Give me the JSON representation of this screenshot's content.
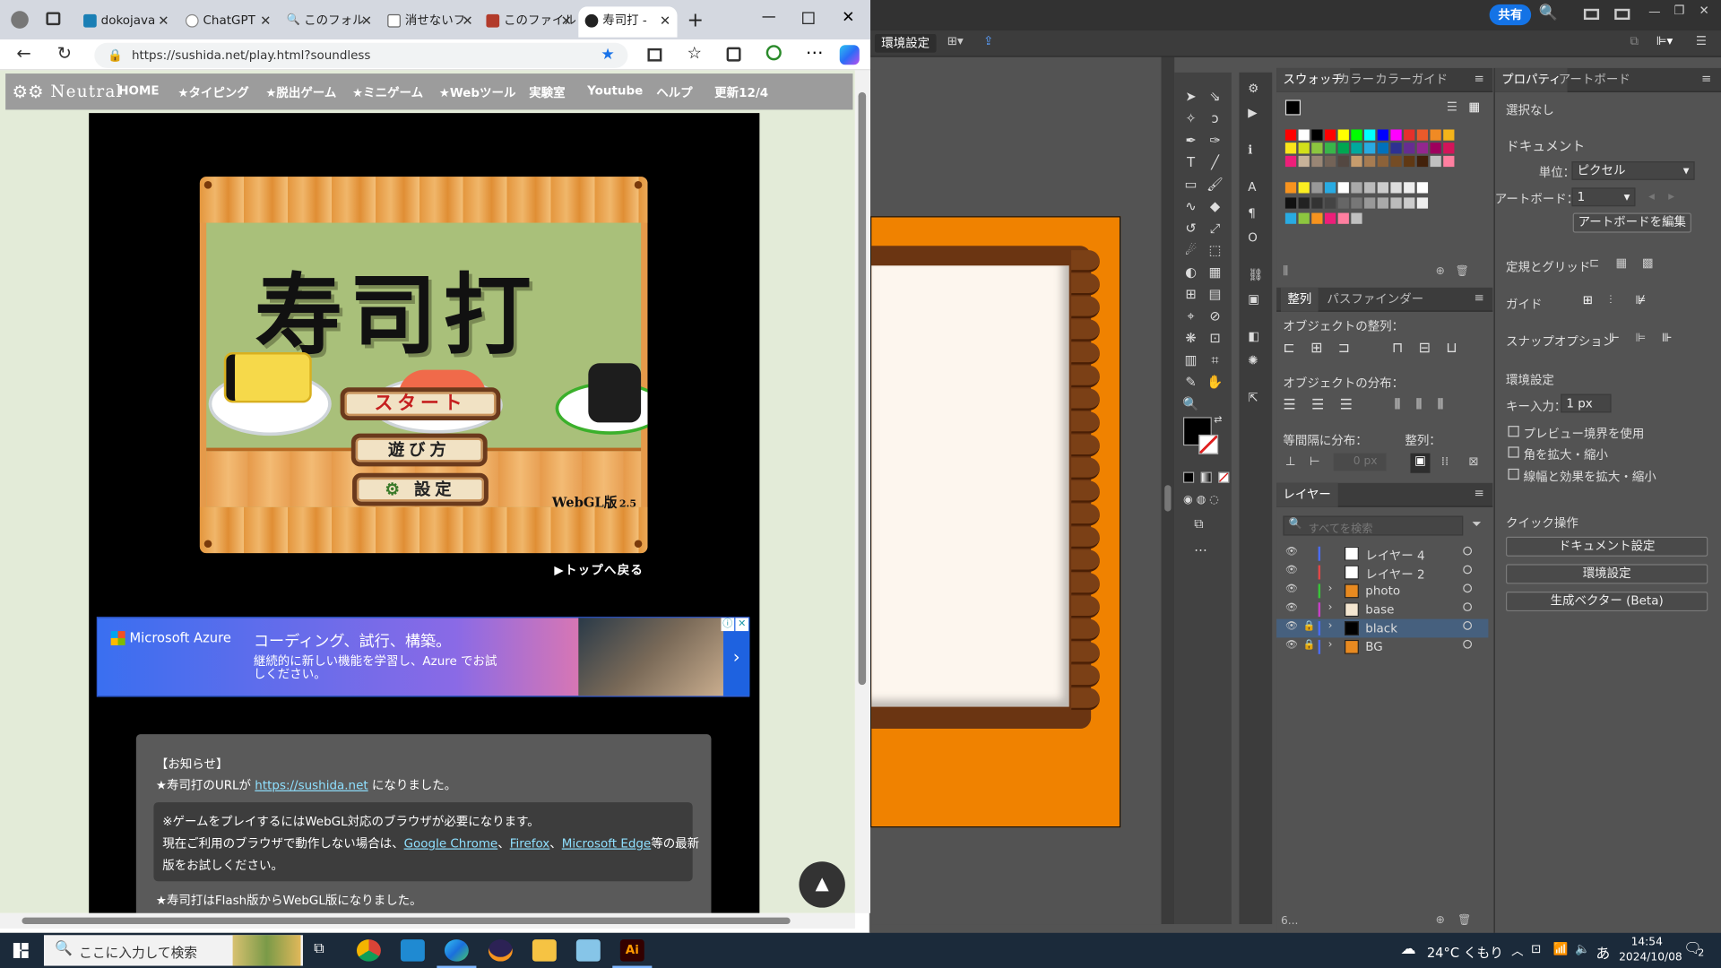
{
  "browser": {
    "tabs": [
      {
        "label": "dokojava",
        "color": "#1a7fb5"
      },
      {
        "label": "ChatGPT",
        "color": "#888888"
      },
      {
        "label": "このフォル",
        "color": "#aaaaaa"
      },
      {
        "label": "消せないフ",
        "color": "#aaaaaa"
      },
      {
        "label": "このファイル",
        "color": "#b23b2b"
      },
      {
        "label": "寿司打 - ",
        "color": "#222222"
      }
    ],
    "new_tab": "+",
    "url": "https://sushida.net/play.html?soundless"
  },
  "site": {
    "logo": "Neutral",
    "nav": [
      "HOME",
      "★タイピング",
      "★脱出ゲーム",
      "★ミニゲーム",
      "★Webツール",
      "実験室",
      "Youtube",
      "ヘルプ",
      "更新12/4"
    ],
    "game": {
      "title": "寿司打",
      "start": "スタート",
      "howto": "遊び方",
      "settings": "設定",
      "version": "WebGL版",
      "version_num": "2.5"
    },
    "back_to_top": "▶トップへ戻る",
    "ad": {
      "brand": "Microsoft Azure",
      "headline": "コーディング、試行、構築。",
      "body": "継続的に新しい機能を学習し、Azure でお試しください。"
    },
    "notice": {
      "heading": "【お知らせ】",
      "line1_pre": "★寿司打のURLが",
      "line1_link": "https://sushida.net",
      "line1_post": "になりました。",
      "box_line1": "※ゲームをプレイするにはWebGL対応のブラウザが必要になります。",
      "box_line2_pre": "現在ご利用のブラウザで動作しない場合は、",
      "chrome": "Google Chrome",
      "sep": "、",
      "firefox": "Firefox",
      "edge": "Microsoft Edge",
      "box_line2_post": "等の最新",
      "box_line3": "版をお試しください。",
      "line_last": "★寿司打はFlash版からWebGL版になりました。"
    }
  },
  "illustrator": {
    "share": "共有",
    "env_btn": "環境設定",
    "swatch_tabs": [
      "スウォッチ",
      "カラー",
      "カラーガイド"
    ],
    "align_tabs": [
      "整列",
      "パスファインダー"
    ],
    "align_objects": "オブジェクトの整列：",
    "distribute_objects": "オブジェクトの分布：",
    "equal_spacing": "等間隔に分布：",
    "align_to": "整列：",
    "spacing_value": "0 px",
    "layers_tab": "レイヤー",
    "layers_search": "すべてを検索",
    "layers": [
      {
        "name": "レイヤー 4",
        "color": "#4b6cf0",
        "locked": false,
        "expandable": false
      },
      {
        "name": "レイヤー 2",
        "color": "#e04848",
        "locked": false,
        "expandable": false
      },
      {
        "name": "photo",
        "color": "#39c339",
        "locked": false,
        "expandable": true
      },
      {
        "name": "base",
        "color": "#c640c6",
        "locked": false,
        "expandable": true
      },
      {
        "name": "black",
        "color": "#4b6cf0",
        "locked": true,
        "expandable": true
      },
      {
        "name": "BG",
        "color": "#4b6cf0",
        "locked": true,
        "expandable": true
      }
    ],
    "layers_count": "6...",
    "props_tabs": [
      "プロパティ",
      "アートボード"
    ],
    "selection": "選択なし",
    "document": "ドキュメント",
    "unit_label": "単位：",
    "unit_value": "ピクセル",
    "artboard_label": "アートボード：",
    "artboard_value": "1",
    "edit_artboard": "アートボードを編集",
    "rulers_grids": "定規とグリッド",
    "guides": "ガイド",
    "snap_options": "スナップオプション",
    "preferences": "環境設定",
    "key_input_label": "キー入力：",
    "key_input_value": "1 px",
    "cb_preview": "プレビュー境界を使用",
    "cb_corners": "角を拡大・縮小",
    "cb_strokes": "線幅と効果を拡大・縮小",
    "quick_actions": "クイック操作",
    "doc_setup": "ドキュメント設定",
    "prefs_btn": "環境設定",
    "gen_vector": "生成ベクター (Beta)"
  },
  "taskbar": {
    "search": "ここに入力して検索",
    "weather": "24°C くもり",
    "time": "14:54",
    "date": "2024/10/08",
    "ime": "あ",
    "notif_count": "2"
  }
}
